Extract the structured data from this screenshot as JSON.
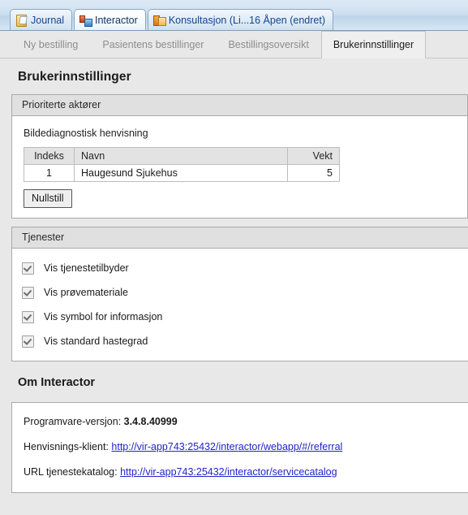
{
  "window_tabs": [
    {
      "label": "Journal",
      "icon": "journal-icon",
      "active": false
    },
    {
      "label": "Interactor",
      "icon": "network-icon",
      "active": true
    },
    {
      "label": "Konsultasjon (Li...16 Åpen (endret)",
      "icon": "consultation-icon",
      "active": false
    }
  ],
  "page_tabs": [
    {
      "label": "Ny bestilling",
      "active": false
    },
    {
      "label": "Pasientens bestillinger",
      "active": false
    },
    {
      "label": "Bestillingsoversikt",
      "active": false
    },
    {
      "label": "Brukerinnstillinger",
      "active": true
    }
  ],
  "page": {
    "title": "Brukerinnstillinger"
  },
  "priority_actors": {
    "header": "Prioriterte aktører",
    "field_label": "Bildediagnostisk henvisning",
    "table": {
      "columns": [
        "Indeks",
        "Navn",
        "Vekt"
      ],
      "rows": [
        {
          "indeks": "1",
          "navn": "Haugesund Sjukehus",
          "vekt": "5"
        }
      ]
    },
    "reset_button": "Nullstill"
  },
  "services": {
    "header": "Tjenester",
    "options": [
      {
        "label": "Vis tjenestetilbyder",
        "checked": true
      },
      {
        "label": "Vis prøvemateriale",
        "checked": true
      },
      {
        "label": "Vis symbol for informasjon",
        "checked": true
      },
      {
        "label": "Vis standard hastegrad",
        "checked": true
      }
    ]
  },
  "about": {
    "title": "Om Interactor",
    "version_label": "Programvare-versjon:",
    "version_value": "3.4.8.40999",
    "referral_client_label": "Henvisnings-klient:",
    "referral_client_url": "http://vir-app743:25432/interactor/webapp/#/referral",
    "service_catalog_label": "URL tjenestekatalog:",
    "service_catalog_url": "http://vir-app743:25432/interactor/servicecatalog"
  },
  "colors": {
    "page_background": "#e8e8e8",
    "panel_background": "#ffffff",
    "group_header": "#e0e0e0",
    "border": "#a9a9a9",
    "tab_bar": "#cfe0f0",
    "tab_text": "#15458a",
    "inactive_tab_text": "#8d8d8d",
    "link": "#2323c8"
  }
}
